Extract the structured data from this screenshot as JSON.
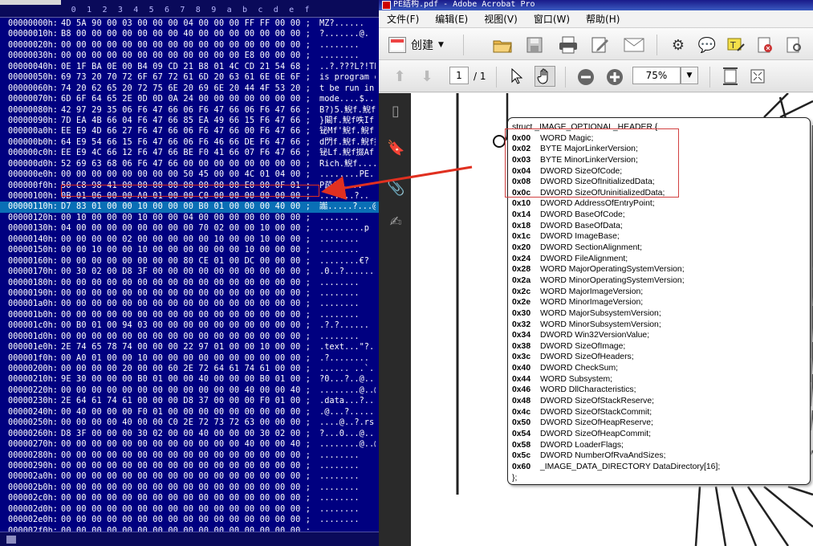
{
  "hex_editor": {
    "column_header": [
      "0",
      "1",
      "2",
      "3",
      "4",
      "5",
      "6",
      "7",
      "8",
      "9",
      "a",
      "b",
      "c",
      "d",
      "e",
      "f"
    ],
    "rows": [
      {
        "offset": "00000000h:",
        "bytes": "4D 5A 90 00 03 00 00 00 04 00 00 00 FF FF 00 00 ;",
        "ascii": "MZ?......"
      },
      {
        "offset": "00000010h:",
        "bytes": "B8 00 00 00 00 00 00 00 40 00 00 00 00 00 00 00 ;",
        "ascii": "?.......@."
      },
      {
        "offset": "00000020h:",
        "bytes": "00 00 00 00 00 00 00 00 00 00 00 00 00 00 00 00 ;",
        "ascii": "........"
      },
      {
        "offset": "00000030h:",
        "bytes": "00 00 00 00 00 00 00 00 00 00 00 00 E8 00 00 00 ;",
        "ascii": "........"
      },
      {
        "offset": "00000040h:",
        "bytes": "0E 1F BA 0E 00 B4 09 CD 21 B8 01 4C CD 21 54 68 ;",
        "ascii": "..?.???L?!Th"
      },
      {
        "offset": "00000050h:",
        "bytes": "69 73 20 70 72 6F 67 72 61 6D 20 63 61 6E 6E 6F ;",
        "ascii": "is program ca"
      },
      {
        "offset": "00000060h:",
        "bytes": "74 20 62 65 20 72 75 6E 20 69 6E 20 44 4F 53 20 ;",
        "ascii": "t be run in D"
      },
      {
        "offset": "00000070h:",
        "bytes": "6D 6F 64 65 2E 0D 0D 0A 24 00 00 00 00 00 00 00 ;",
        "ascii": "mode....$..."
      },
      {
        "offset": "00000080h:",
        "bytes": "42 97 29 35 06 F6 47 66 06 F6 47 66 06 F6 47 66 ;",
        "ascii": "B?)5.鯢f.鯢f."
      },
      {
        "offset": "00000090h:",
        "bytes": "7D EA 4B 66 04 F6 47 66 85 EA 49 66 15 F6 47 66 ;",
        "ascii": "}闞f.鯢f呹If.鯢"
      },
      {
        "offset": "000000a0h:",
        "bytes": "EE E9 4D 66 27 F6 47 66 06 F6 47 66 00 F6 47 66 ;",
        "ascii": "铋Mf'鯢f.鯢f.鯢"
      },
      {
        "offset": "000000b0h:",
        "bytes": "64 E9 54 66 15 F6 47 66 06 F6 46 66 DE F6 47 66 ;",
        "ascii": "d閁f.鯢f.鯢f挢"
      },
      {
        "offset": "000000c0h:",
        "bytes": "EE E9 4C 66 12 F6 47 66 BE F0 41 66 07 F6 47 66 ;",
        "ascii": "铋Lf.鯢f掇Af.鯢"
      },
      {
        "offset": "000000d0h:",
        "bytes": "52 69 63 68 06 F6 47 66 00 00 00 00 00 00 00 00 ;",
        "ascii": "Rich.鯢f...."
      },
      {
        "offset": "000000e0h:",
        "bytes": "00 00 00 00 00 00 00 00 50 45 00 00 4C 01 04 00 ;",
        "ascii": "........PE.."
      },
      {
        "offset": "000000f0h:",
        "bytes": "50 C8 98 41 00 00 00 00 00 00 00 00 E0 00 0F 01 ;",
        "ascii": "P葮A....."
      },
      {
        "offset": "00000100h:",
        "bytes": "0B 01 06 00 00 A0 01 00 00 C0 00 00 00 00 00 00 ;",
        "ascii": "....?..?.."
      },
      {
        "offset": "00000110h:",
        "bytes": "D7 83 01 00 00 10 00 00 00 B0 01 00 00 00 40 00 ;",
        "ascii": "讟.....?...@."
      },
      {
        "offset": "00000120h:",
        "bytes": "00 10 00 00 00 10 00 00 04 00 00 00 00 00 00 00 ;",
        "ascii": "........"
      },
      {
        "offset": "00000130h:",
        "bytes": "04 00 00 00 00 00 00 00 00 70 02 00 00 10 00 00 ;",
        "ascii": ".........p"
      },
      {
        "offset": "00000140h:",
        "bytes": "00 00 00 00 02 00 00 00 00 00 10 00 00 10 00 00 ;",
        "ascii": "........"
      },
      {
        "offset": "00000150h:",
        "bytes": "00 00 10 00 00 10 00 00 00 00 00 00 10 00 00 00 ;",
        "ascii": "........"
      },
      {
        "offset": "00000160h:",
        "bytes": "00 00 00 00 00 00 00 00 80 CE 01 00 DC 00 00 00 ;",
        "ascii": "........€?"
      },
      {
        "offset": "00000170h:",
        "bytes": "00 30 02 00 D8 3F 00 00 00 00 00 00 00 00 00 00 ;",
        "ascii": ".0..?......"
      },
      {
        "offset": "00000180h:",
        "bytes": "00 00 00 00 00 00 00 00 00 00 00 00 00 00 00 00 ;",
        "ascii": "........"
      },
      {
        "offset": "00000190h:",
        "bytes": "00 00 00 00 00 00 00 00 00 00 00 00 00 00 00 00 ;",
        "ascii": "........"
      },
      {
        "offset": "000001a0h:",
        "bytes": "00 00 00 00 00 00 00 00 00 00 00 00 00 00 00 00 ;",
        "ascii": "........"
      },
      {
        "offset": "000001b0h:",
        "bytes": "00 00 00 00 00 00 00 00 00 00 00 00 00 00 00 00 ;",
        "ascii": "........"
      },
      {
        "offset": "000001c0h:",
        "bytes": "00 B0 01 00 94 03 00 00 00 00 00 00 00 00 00 00 ;",
        "ascii": ".?.?......"
      },
      {
        "offset": "000001d0h:",
        "bytes": "00 00 00 00 00 00 00 00 00 00 00 00 00 00 00 00 ;",
        "ascii": "........"
      },
      {
        "offset": "000001e0h:",
        "bytes": "2E 74 65 78 74 00 00 00 22 97 01 00 00 10 00 00 ;",
        "ascii": ".text...\"?."
      },
      {
        "offset": "000001f0h:",
        "bytes": "00 A0 01 00 00 10 00 00 00 00 00 00 00 00 00 00 ;",
        "ascii": ".?........"
      },
      {
        "offset": "00000200h:",
        "bytes": "00 00 00 00 20 00 00 60 2E 72 64 61 74 61 00 00 ;",
        "ascii": "...... ..`.rdata"
      },
      {
        "offset": "00000210h:",
        "bytes": "9E 30 00 00 00 B0 01 00 00 40 00 00 00 B0 01 00 ;",
        "ascii": "?0...?..@...?"
      },
      {
        "offset": "00000220h:",
        "bytes": "00 00 00 00 00 00 00 00 00 00 00 00 40 00 00 40 ;",
        "ascii": "........@..@"
      },
      {
        "offset": "00000230h:",
        "bytes": "2E 64 61 74 61 00 00 00 D8 37 00 00 00 F0 01 00 ;",
        "ascii": ".data...?...?."
      },
      {
        "offset": "00000240h:",
        "bytes": "00 40 00 00 00 F0 01 00 00 00 00 00 00 00 00 00 ;",
        "ascii": ".@...?......"
      },
      {
        "offset": "00000250h:",
        "bytes": "00 00 00 00 40 00 00 C0 2E 72 73 72 63 00 00 00 ;",
        "ascii": "....@..?.rsrc"
      },
      {
        "offset": "00000260h:",
        "bytes": "D8 3F 00 00 00 30 02 00 00 40 00 00 00 30 02 00 ;",
        "ascii": "?...0...@...0."
      },
      {
        "offset": "00000270h:",
        "bytes": "00 00 00 00 00 00 00 00 00 00 00 00 40 00 00 40 ;",
        "ascii": "........@..@"
      },
      {
        "offset": "00000280h:",
        "bytes": "00 00 00 00 00 00 00 00 00 00 00 00 00 00 00 00 ;",
        "ascii": "........"
      },
      {
        "offset": "00000290h:",
        "bytes": "00 00 00 00 00 00 00 00 00 00 00 00 00 00 00 00 ;",
        "ascii": "........"
      },
      {
        "offset": "000002a0h:",
        "bytes": "00 00 00 00 00 00 00 00 00 00 00 00 00 00 00 00 ;",
        "ascii": "........"
      },
      {
        "offset": "000002b0h:",
        "bytes": "00 00 00 00 00 00 00 00 00 00 00 00 00 00 00 00 ;",
        "ascii": "........"
      },
      {
        "offset": "000002c0h:",
        "bytes": "00 00 00 00 00 00 00 00 00 00 00 00 00 00 00 00 ;",
        "ascii": "........"
      },
      {
        "offset": "000002d0h:",
        "bytes": "00 00 00 00 00 00 00 00 00 00 00 00 00 00 00 00 ;",
        "ascii": "........"
      },
      {
        "offset": "000002e0h:",
        "bytes": "00 00 00 00 00 00 00 00 00 00 00 00 00 00 00 00 ;",
        "ascii": "........"
      },
      {
        "offset": "000002f0h:",
        "bytes": "00 00 00 00 00 00 00 00 00 00 00 00 00 00 00 00 ;",
        "ascii": "........"
      },
      {
        "offset": "00000300h:",
        "bytes": "00 00 00 00 00 00 00 00 00 00 00 00 00 00 00 00 ;",
        "ascii": "........"
      }
    ],
    "selected_offset": "00000110h:"
  },
  "acrobat": {
    "window_title": "PE结构.pdf - Adobe Acrobat Pro",
    "menu": [
      "文件(F)",
      "编辑(E)",
      "视图(V)",
      "窗口(W)",
      "帮助(H)"
    ],
    "create_label": "创建",
    "page_current": "1",
    "page_total": "/ 1",
    "zoom": "75%",
    "struct": {
      "header": "struct _IMAGE_OPTIONAL_HEADER {",
      "fields": [
        {
          "offset": "0x00",
          "decl": "WORD Magic;"
        },
        {
          "offset": "0x02",
          "decl": "BYTE MajorLinkerVersion;"
        },
        {
          "offset": "0x03",
          "decl": "BYTE MinorLinkerVersion;"
        },
        {
          "offset": "0x04",
          "decl": "DWORD SizeOfCode;"
        },
        {
          "offset": "0x08",
          "decl": "DWORD SizeOfInitializedData;"
        },
        {
          "offset": "0x0c",
          "decl": "DWORD SizeOfUninitializedData;"
        },
        {
          "offset": "0x10",
          "decl": "DWORD AddressOfEntryPoint;"
        },
        {
          "offset": "0x14",
          "decl": "DWORD BaseOfCode;"
        },
        {
          "offset": "0x18",
          "decl": "DWORD BaseOfData;"
        },
        {
          "offset": "0x1c",
          "decl": "DWORD ImageBase;"
        },
        {
          "offset": "0x20",
          "decl": "DWORD SectionAlignment;"
        },
        {
          "offset": "0x24",
          "decl": "DWORD FileAlignment;"
        },
        {
          "offset": "0x28",
          "decl": "WORD MajorOperatingSystemVersion;"
        },
        {
          "offset": "0x2a",
          "decl": "WORD MinorOperatingSystemVersion;"
        },
        {
          "offset": "0x2c",
          "decl": "WORD MajorImageVersion;"
        },
        {
          "offset": "0x2e",
          "decl": "WORD MinorImageVersion;"
        },
        {
          "offset": "0x30",
          "decl": "WORD MajorSubsystemVersion;"
        },
        {
          "offset": "0x32",
          "decl": "WORD MinorSubsystemVersion;"
        },
        {
          "offset": "0x34",
          "decl": "DWORD Win32VersionValue;"
        },
        {
          "offset": "0x38",
          "decl": "DWORD SizeOfImage;"
        },
        {
          "offset": "0x3c",
          "decl": "DWORD SizeOfHeaders;"
        },
        {
          "offset": "0x40",
          "decl": "DWORD CheckSum;"
        },
        {
          "offset": "0x44",
          "decl": "WORD Subsystem;"
        },
        {
          "offset": "0x46",
          "decl": "WORD DllCharacteristics;"
        },
        {
          "offset": "0x48",
          "decl": "DWORD SizeOfStackReserve;"
        },
        {
          "offset": "0x4c",
          "decl": "DWORD SizeOfStackCommit;"
        },
        {
          "offset": "0x50",
          "decl": "DWORD SizeOfHeapReserve;"
        },
        {
          "offset": "0x54",
          "decl": "DWORD SizeOfHeapCommit;"
        },
        {
          "offset": "0x58",
          "decl": "DWORD LoaderFlags;"
        },
        {
          "offset": "0x5c",
          "decl": "DWORD NumberOfRvaAndSizes;"
        },
        {
          "offset": "0x60",
          "decl": "_IMAGE_DATA_DIRECTORY DataDirectory[16];"
        }
      ],
      "footer": "};"
    }
  },
  "colors": {
    "hex_bg": "#000080",
    "hex_selected": "#0a6fb6",
    "highlight_red": "#e03020"
  }
}
